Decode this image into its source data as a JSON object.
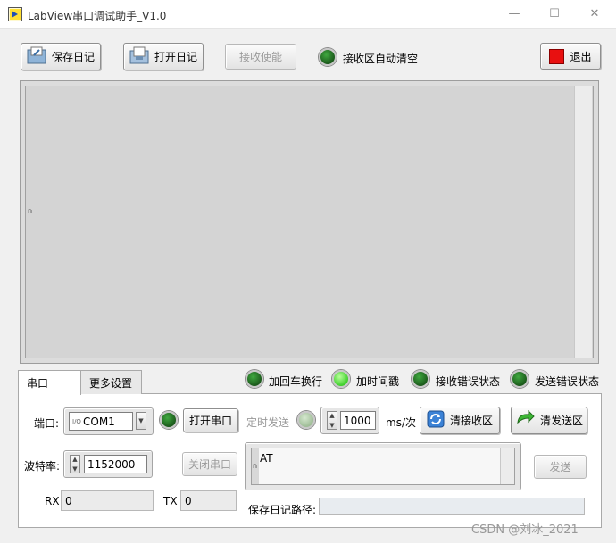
{
  "window": {
    "title": "LabView串口调试助手_V1.0"
  },
  "toolbar": {
    "save_log": "保存日记",
    "open_log": "打开日记",
    "recv_enable": "接收使能",
    "auto_clear_label": "接收区自动清空",
    "exit": "退出"
  },
  "receive": {
    "row_marker": "n"
  },
  "tabs": [
    {
      "label": "串口"
    },
    {
      "label": "更多设置"
    }
  ],
  "indicators": {
    "add_crlf": "加回车换行",
    "add_timestamp": "加时间戳",
    "recv_error": "接收错误状态",
    "send_error": "发送错误状态"
  },
  "serial": {
    "port_label": "端口:",
    "port_io_glyph": "I/O",
    "port_value": "COM1",
    "open_port": "打开串口",
    "close_port": "关闭串口",
    "timed_send": "定时发送",
    "interval_value": "1000",
    "interval_unit": "ms/次",
    "clear_recv": "清接收区",
    "clear_send": "清发送区",
    "baud_label": "波特率:",
    "baud_value": "1152000",
    "send_text": "AT",
    "send_marker": "n",
    "send_button": "发送",
    "rx_label": "RX",
    "rx_value": "0",
    "tx_label": "TX",
    "tx_value": "0",
    "log_path_label": "保存日记路径:",
    "log_path_value": ""
  },
  "watermark": "CSDN @刘冰_2021",
  "colors": {
    "led_on": "#3fcf2c",
    "led_off": "#1c5a1c",
    "exit_red": "#e81010"
  }
}
